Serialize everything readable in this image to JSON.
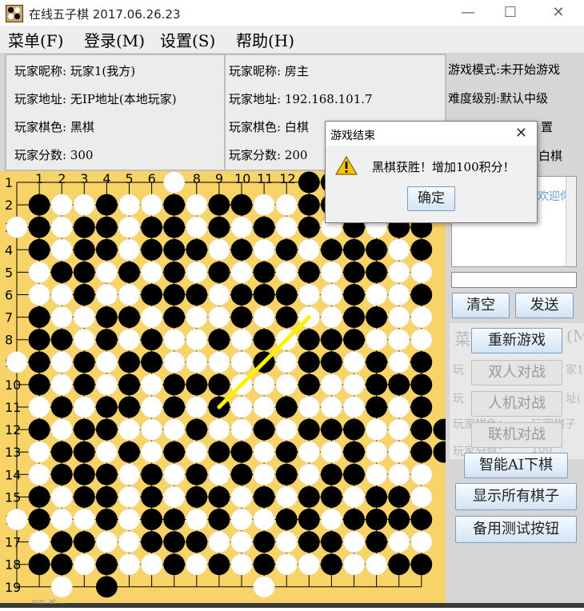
{
  "window": {
    "title": "在线五子棋 2017.06.26.23",
    "icon": "gomoku-app-icon"
  },
  "menu": [
    "菜单(F)",
    "登录(M)",
    "设置(S)",
    "帮助(H)"
  ],
  "player_self": {
    "name": "玩家昵称: 玩家1(我方)",
    "address": "玩家地址: 无IP地址(本地玩家)",
    "color": "玩家棋色: 黑棋",
    "score": "玩家分数: 300"
  },
  "player_opponent": {
    "name": "玩家昵称: 房主",
    "address": "玩家地址: 192.168.101.7",
    "color": "玩家棋色: 白棋",
    "score": "玩家分数: 200"
  },
  "game_info": {
    "mode": "游戏模式:未开始游戏",
    "level": "难度级别:默认中级",
    "line3_partial": "置",
    "line4_partial": "白棋"
  },
  "board": {
    "row_labels": [
      "1",
      "2",
      "3",
      "4",
      "5",
      "6",
      "7",
      "8",
      "9",
      "10",
      "11",
      "12",
      "13",
      "14",
      "15",
      "16",
      "17",
      "18",
      "19"
    ],
    "col_labels": [
      "1",
      "2",
      "3",
      "4",
      "5",
      "6",
      "7",
      "8",
      "9",
      "10",
      "11",
      "12",
      "13",
      "14"
    ],
    "board_color": "#f8d468",
    "rows": [
      ".......W.....BB....",
      ".BWWBWWBWBBWWBBBWWB",
      "WBWBBWBBWBWBWBWBWBB",
      ".BWBBWBBBWBWBWBBBWB",
      ".WBBWBWBWBWBWBWBBWW",
      ".WWBWWBBBWBBBWWBWWB",
      ".BWWBBWBWWBWBWWBBWW",
      ".BBWBWBWWBWBWBBBWWW",
      "WBWBWBBWWWWBWBBWBWB",
      ".BWBWBWBBBWWWBWWBBB",
      ".WBWBBWBWBWWBWWWBWB",
      ".BWBBWWWBWWBWBBBWWBB",
      ".WBBWBWBWBBWBWWBWWBB",
      ".WBBBWBWBWBWBWBBWWW",
      ".BWBBWBWBBWBWBBWBBW",
      "WBWWBWBBWBWWBBWBBBB",
      ".WBBWWBBBWWBWBBWBWW",
      ".BBWBWWBWBWBWWBWWBB",
      "..W.B......W......."
    ],
    "win_line": {
      "from": [
        9,
        10
      ],
      "to": [
        13,
        6
      ]
    }
  },
  "chat": {
    "welcome_partial": "欢迎你",
    "clear_label": "清空",
    "send_label": "发送",
    "input_value": ""
  },
  "buttons": {
    "restart": "重新游戏",
    "pvp": "双人对战",
    "pve": "人机对战",
    "online": "联机对战",
    "ai_move": "智能AI下棋",
    "show_all": "显示所有棋子",
    "backup_test": "备用测试按钮"
  },
  "ghost_text": {
    "menu": "菜",
    "menu_tail": "(M",
    "line1": "玩",
    "line1_tail": "家1",
    "line2": "玩",
    "line2_tail": "址(",
    "line3": "玩家棋色：",
    "line3_tail": "玩家棋子",
    "line4": "玩家分数：",
    "line4_tail": "100"
  },
  "dialog": {
    "title": "游戏结束",
    "message": "黑棋获胜！增加100积分！",
    "ok_label": "确定",
    "icon": "warning-icon"
  },
  "console_text": "run: at ... "
}
